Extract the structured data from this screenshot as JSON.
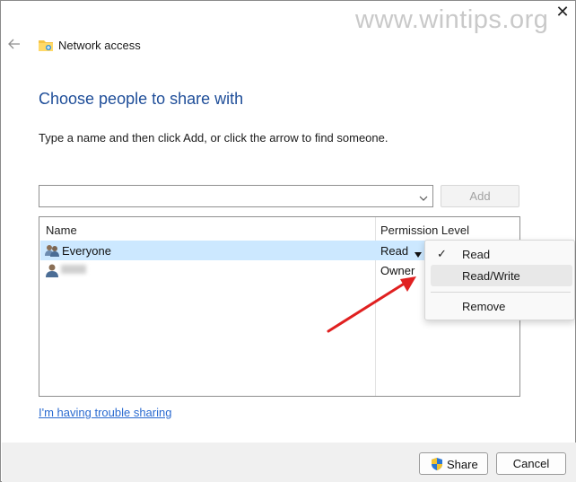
{
  "window": {
    "title": "Network access",
    "watermark": "www.wintips.org",
    "icons": {
      "back": "back-arrow-icon",
      "app": "shared-folder-icon",
      "close": "close-icon"
    }
  },
  "main": {
    "heading": "Choose people to share with",
    "instructions": "Type a name and then click Add, or click the arrow to find someone.",
    "name_input": {
      "value": "",
      "placeholder": ""
    },
    "add_label": "Add"
  },
  "table": {
    "columns": [
      "Name",
      "Permission Level"
    ],
    "rows": [
      {
        "name": "Everyone",
        "permission": "Read",
        "icon": "group-users-icon",
        "selected": true
      },
      {
        "name": "",
        "permission": "Owner",
        "icon": "user-icon",
        "selected": false
      }
    ]
  },
  "context_menu": {
    "items": [
      {
        "label": "Read",
        "checked": true
      },
      {
        "label": "Read/Write",
        "checked": false,
        "hovered": true
      },
      {
        "label": "Remove",
        "checked": false
      }
    ]
  },
  "links": {
    "trouble": "I'm having trouble sharing"
  },
  "footer": {
    "share_label": "Share",
    "cancel_label": "Cancel",
    "share_icon": "uac-shield-icon"
  },
  "colors": {
    "heading": "#1f4e99",
    "selection": "#cce8ff",
    "link": "#2a6ad0",
    "annotation_arrow": "#e02020"
  }
}
